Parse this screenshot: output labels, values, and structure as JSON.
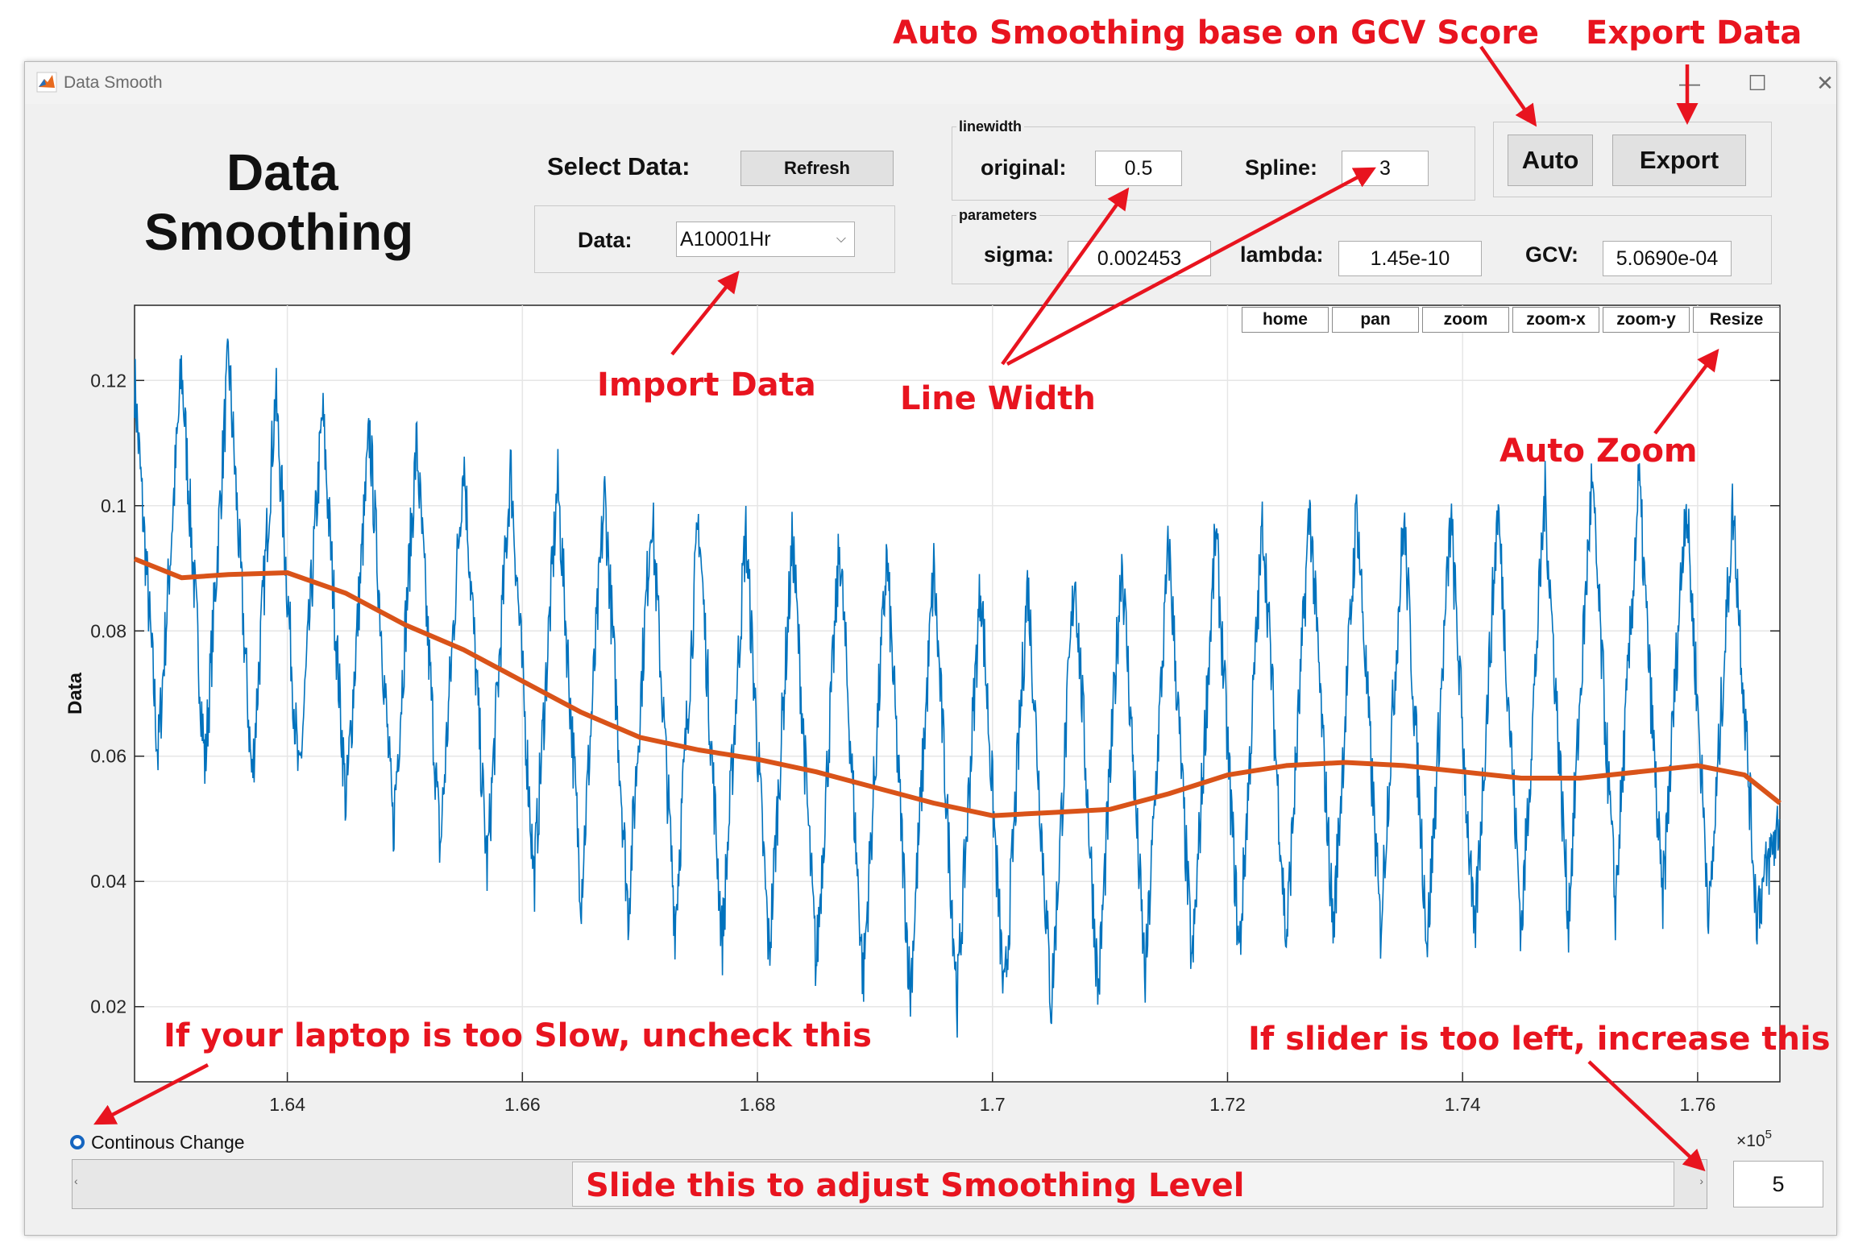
{
  "window": {
    "title": "Data Smooth",
    "controls": {
      "minimize": "—",
      "maximize": "☐",
      "close": "✕"
    }
  },
  "app_title": [
    "Data",
    "Smoothing"
  ],
  "select_data": {
    "label": "Select Data:",
    "refresh_label": "Refresh",
    "data_label": "Data:",
    "data_value": "A10001Hr"
  },
  "linewidth": {
    "title": "linewidth",
    "original_label": "original:",
    "original_value": "0.5",
    "spline_label": "Spline:",
    "spline_value": "3"
  },
  "parameters": {
    "title": "parameters",
    "sigma_label": "sigma:",
    "sigma_value": "0.002453",
    "lambda_label": "lambda:",
    "lambda_value": "1.45e-10",
    "gcv_label": "GCV:",
    "gcv_value": "5.0690e-04"
  },
  "buttons": {
    "auto": "Auto",
    "export": "Export"
  },
  "plot_toolbar": [
    "home",
    "pan",
    "zoom",
    "zoom-x",
    "zoom-y",
    "Resize"
  ],
  "controls": {
    "continuous_label": "Continous Change",
    "continuous_checked": true,
    "level_value": "5"
  },
  "annotations": {
    "auto_smoothing": "Auto Smoothing base on GCV Score",
    "export_data": "Export Data",
    "import_data": "Import Data",
    "line_width": "Line Width",
    "auto_zoom": "Auto Zoom",
    "laptop_slow": "If your laptop is too Slow, uncheck this",
    "slider_left": "If slider is too left, increase this",
    "slide_adjust": "Slide this to adjust Smoothing Level"
  },
  "colors": {
    "raw": "#0072bd",
    "spline": "#d95319",
    "annotation": "#e8141f",
    "window_bg": "#f0f0f0"
  },
  "chart_data": {
    "type": "line",
    "title": "",
    "xlabel": "",
    "ylabel": "Data",
    "x_multiplier": "×10^5",
    "xlim": [
      1.627,
      1.767
    ],
    "ylim": [
      0.008,
      0.132
    ],
    "x_ticks": [
      "1.64",
      "1.66",
      "1.68",
      "1.7",
      "1.72",
      "1.74",
      "1.76"
    ],
    "x_tick_values": [
      1.64,
      1.66,
      1.68,
      1.7,
      1.72,
      1.74,
      1.76
    ],
    "y_ticks": [
      "0.02",
      "0.04",
      "0.06",
      "0.08",
      "0.1",
      "0.12"
    ],
    "y_tick_values": [
      0.02,
      0.04,
      0.06,
      0.08,
      0.1,
      0.12
    ],
    "grid": true,
    "series": [
      {
        "role": "smoothed spline",
        "x": [
          1.627,
          1.631,
          1.635,
          1.64,
          1.645,
          1.65,
          1.655,
          1.66,
          1.665,
          1.67,
          1.675,
          1.68,
          1.685,
          1.69,
          1.695,
          1.7,
          1.705,
          1.71,
          1.715,
          1.72,
          1.725,
          1.73,
          1.735,
          1.74,
          1.745,
          1.75,
          1.755,
          1.76,
          1.764,
          1.767
        ],
        "y": [
          0.0915,
          0.0885,
          0.089,
          0.0893,
          0.086,
          0.081,
          0.077,
          0.072,
          0.067,
          0.063,
          0.061,
          0.0595,
          0.0575,
          0.055,
          0.0525,
          0.0505,
          0.051,
          0.0515,
          0.054,
          0.057,
          0.0585,
          0.059,
          0.0585,
          0.0575,
          0.0565,
          0.0565,
          0.0575,
          0.0585,
          0.057,
          0.0525
        ]
      },
      {
        "role": "original data (oscillating)",
        "x": [
          1.627,
          1.629,
          1.631,
          1.633,
          1.635,
          1.637,
          1.639,
          1.641,
          1.643,
          1.645,
          1.647,
          1.649,
          1.651,
          1.653,
          1.655,
          1.657,
          1.659,
          1.661,
          1.663,
          1.665,
          1.667,
          1.669,
          1.671,
          1.673,
          1.675,
          1.677,
          1.679,
          1.681,
          1.683,
          1.685,
          1.687,
          1.689,
          1.691,
          1.693,
          1.695,
          1.697,
          1.699,
          1.701,
          1.703,
          1.705,
          1.707,
          1.709,
          1.711,
          1.713,
          1.715,
          1.717,
          1.719,
          1.721,
          1.723,
          1.725,
          1.727,
          1.729,
          1.731,
          1.733,
          1.735,
          1.737,
          1.739,
          1.741,
          1.743,
          1.745,
          1.747,
          1.749,
          1.751,
          1.753,
          1.755,
          1.757,
          1.759,
          1.761,
          1.763,
          1.765,
          1.767
        ],
        "y": [
          0.12,
          0.06,
          0.122,
          0.058,
          0.124,
          0.056,
          0.118,
          0.055,
          0.115,
          0.052,
          0.112,
          0.048,
          0.11,
          0.045,
          0.108,
          0.042,
          0.106,
          0.04,
          0.104,
          0.038,
          0.102,
          0.035,
          0.1,
          0.033,
          0.098,
          0.03,
          0.096,
          0.028,
          0.095,
          0.026,
          0.094,
          0.024,
          0.092,
          0.022,
          0.09,
          0.021,
          0.088,
          0.02,
          0.088,
          0.02,
          0.09,
          0.022,
          0.092,
          0.024,
          0.094,
          0.026,
          0.096,
          0.028,
          0.098,
          0.03,
          0.1,
          0.032,
          0.1,
          0.032,
          0.098,
          0.03,
          0.098,
          0.03,
          0.1,
          0.032,
          0.102,
          0.034,
          0.104,
          0.036,
          0.104,
          0.036,
          0.102,
          0.034,
          0.1,
          0.035,
          0.05
        ]
      }
    ]
  }
}
